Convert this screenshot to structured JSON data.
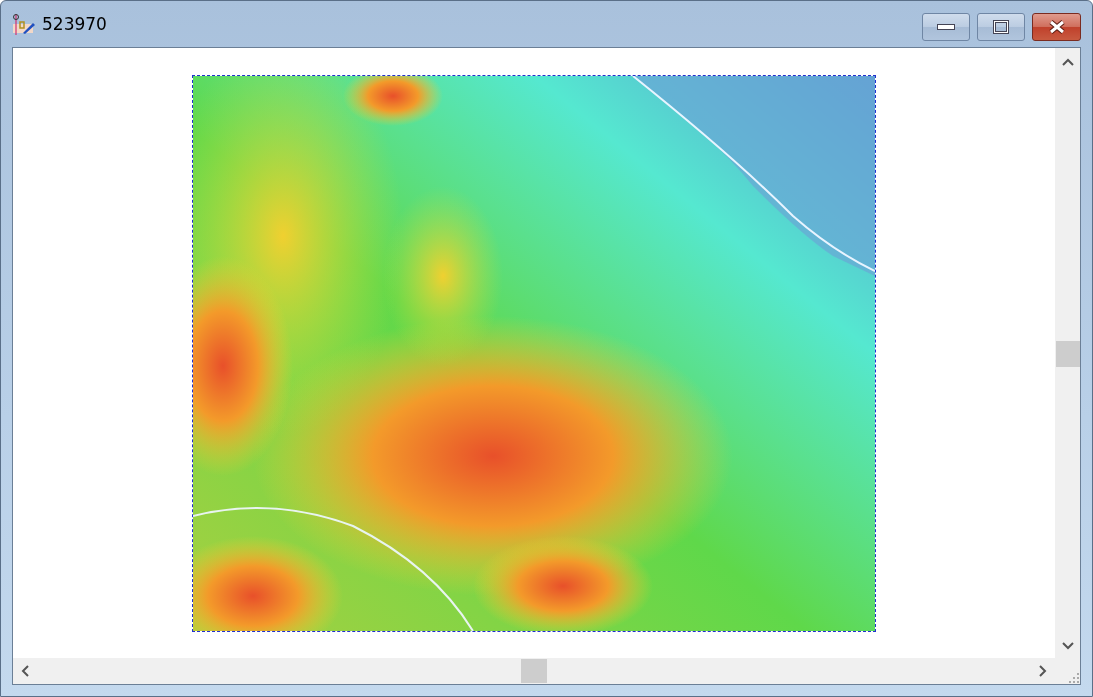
{
  "window": {
    "title": "523970"
  }
}
